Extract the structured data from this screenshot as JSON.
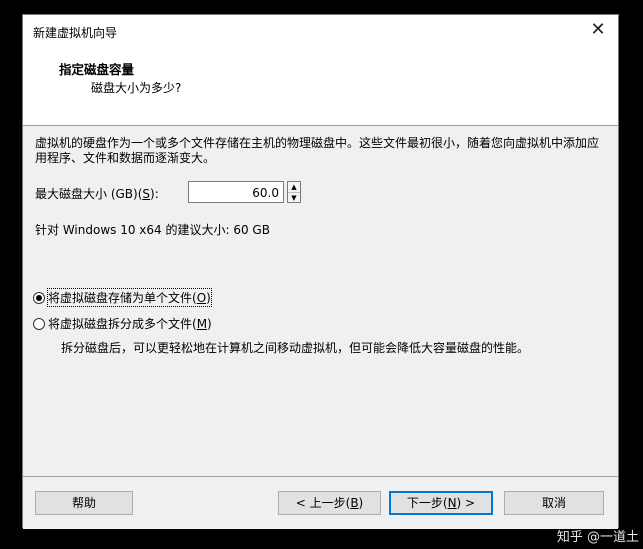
{
  "window": {
    "title": "新建虚拟机向导",
    "close_glyph": "✕"
  },
  "header": {
    "title": "指定磁盘容量",
    "subtitle": "磁盘大小为多少?"
  },
  "body": {
    "description": "虚拟机的硬盘作为一个或多个文件存储在主机的物理磁盘中。这些文件最初很小，随着您向虚拟机中添加应用程序、文件和数据而逐渐变大。",
    "size_label_prefix": "最大磁盘大小 (GB)(",
    "size_label_key": "S",
    "size_label_suffix": "):",
    "size_value": "60.0",
    "recommendation": "针对 Windows 10 x64 的建议大小: 60 GB",
    "options": [
      {
        "label_prefix": "将虚拟磁盘存储为单个文件(",
        "key": "O",
        "label_suffix": ")",
        "selected": true
      },
      {
        "label_prefix": "将虚拟磁盘拆分成多个文件(",
        "key": "M",
        "label_suffix": ")",
        "selected": false
      }
    ],
    "split_description": "拆分磁盘后，可以更轻松地在计算机之间移动虚拟机，但可能会降低大容量磁盘的性能。"
  },
  "footer": {
    "help": "帮助",
    "back_prefix": "< 上一步(",
    "back_key": "B",
    "back_suffix": ")",
    "next_prefix": "下一步(",
    "next_key": "N",
    "next_suffix": ") >",
    "cancel": "取消"
  },
  "watermark": "知乎 @一道土"
}
